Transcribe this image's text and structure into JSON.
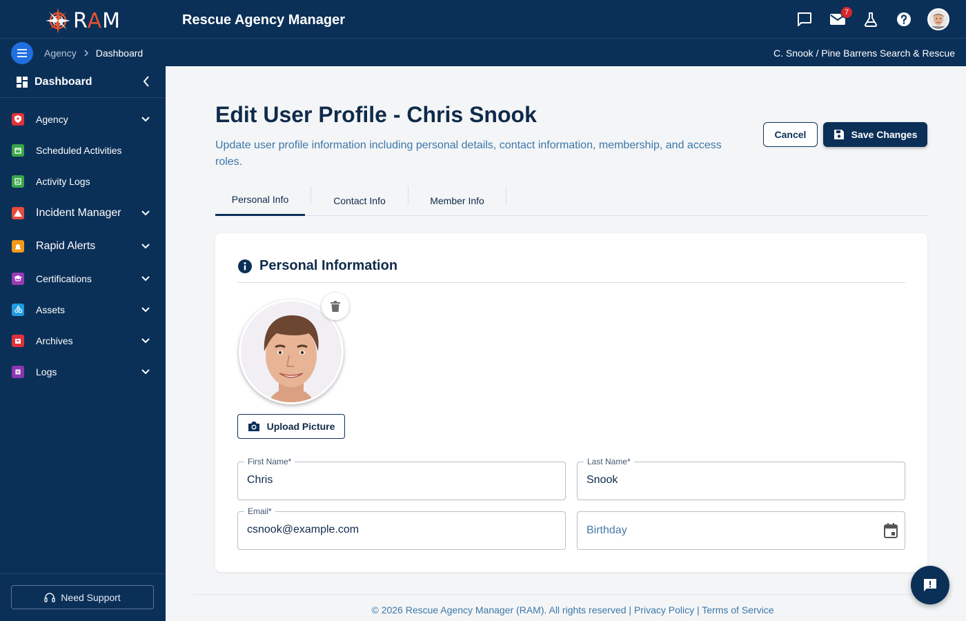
{
  "app": {
    "logo_text_left": "R",
    "logo_text_a": "A",
    "logo_text_right": "M",
    "title": "Rescue Agency Manager"
  },
  "topbar": {
    "mail_badge": "7",
    "icons": [
      "chat-icon",
      "mail-icon",
      "flask-icon",
      "help-icon",
      "user-avatar"
    ]
  },
  "breadcrumb": {
    "items": [
      "Agency",
      "Dashboard"
    ],
    "user_org": "C. Snook / Pine Barrens Search & Rescue"
  },
  "sidebar": {
    "header": "Dashboard",
    "items": [
      {
        "label": "Agency",
        "color": "#e0323a",
        "expandable": true
      },
      {
        "label": "Scheduled Activities",
        "color": "#3aa64a",
        "expandable": false
      },
      {
        "label": "Activity Logs",
        "color": "#3aa64a",
        "expandable": false
      },
      {
        "label": "Incident Manager",
        "color": "#e84a3c",
        "expandable": true
      },
      {
        "label": "Rapid Alerts",
        "color": "#f39a1a",
        "expandable": true
      },
      {
        "label": "Certifications",
        "color": "#9b3ab6",
        "expandable": true
      },
      {
        "label": "Assets",
        "color": "#1e9be0",
        "expandable": true
      },
      {
        "label": "Archives",
        "color": "#e0323a",
        "expandable": true
      },
      {
        "label": "Logs",
        "color": "#8a37b0",
        "expandable": true
      }
    ],
    "support_label": "Need Support"
  },
  "page": {
    "title": "Edit User Profile - Chris Snook",
    "description": "Update user profile information including personal details, contact information, membership, and access roles.",
    "cancel_label": "Cancel",
    "save_label": "Save Changes"
  },
  "tabs": [
    {
      "label": "Personal Info",
      "active": true
    },
    {
      "label": "Contact Info",
      "active": false
    },
    {
      "label": "Member Info",
      "active": false
    }
  ],
  "personal": {
    "section_title": "Personal Information",
    "upload_label": "Upload Picture",
    "first_name": {
      "label": "First Name",
      "required": "*",
      "value": "Chris"
    },
    "last_name": {
      "label": "Last Name",
      "required": "*",
      "value": "Snook"
    },
    "email": {
      "label": "Email",
      "required": "*",
      "value": "csnook@example.com"
    },
    "birthday": {
      "placeholder": "Birthday"
    }
  },
  "footer": {
    "copyright": "© 2026 Rescue Agency Manager (RAM). All rights reserved | ",
    "privacy": "Privacy Policy",
    "sep": " | ",
    "terms": "Terms of Service"
  },
  "colors": {
    "navy": "#0b3058",
    "accent_blue": "#1f6fe0",
    "link_blue": "#3b77a8",
    "badge_red": "#d6262b"
  }
}
